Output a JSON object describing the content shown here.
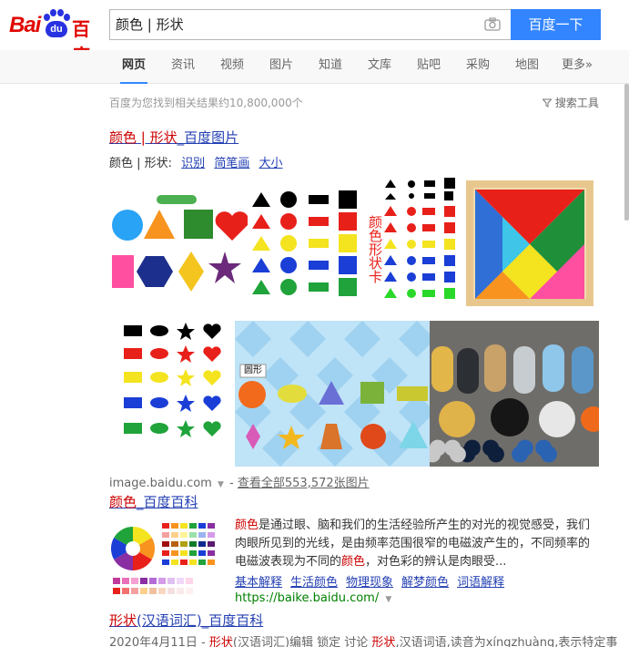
{
  "logo": {
    "text_bai": "Bai",
    "text_du": "du",
    "text_cn": "百度"
  },
  "search": {
    "query": "颜色 | 形状",
    "button_label": "百度一下"
  },
  "tabs": [
    {
      "label": "网页",
      "active": true
    },
    {
      "label": "资讯"
    },
    {
      "label": "视频"
    },
    {
      "label": "图片"
    },
    {
      "label": "知道"
    },
    {
      "label": "文库"
    },
    {
      "label": "贴吧"
    },
    {
      "label": "采购"
    },
    {
      "label": "地图"
    },
    {
      "label": "更多»"
    }
  ],
  "result_count": "百度为您找到相关结果约10,800,000个",
  "search_tools": "搜索工具",
  "result1": {
    "title_em": "颜色 | 形状",
    "title_rest": "_百度图片",
    "sub_prefix": "颜色 | 形状:",
    "sub_links": [
      "识别",
      "简笔画",
      "大小"
    ],
    "tile_text": "颜色形状卡",
    "source": "image.baidu.com",
    "view_all": "查看全部553,572张图片"
  },
  "result2": {
    "title_em": "颜色",
    "title_rest": "_百度百科",
    "desc_em1": "颜色",
    "desc_1": "是通过眼、脑和我们的生活经验所产生的对光的视觉感受，我们肉眼所见到的光线，是由频率范围很窄的电磁波产生的，不同频率的电磁波表现为不同的",
    "desc_em2": "颜色",
    "desc_2": "，对色彩的辨认是肉眼受...",
    "links": [
      "基本解释",
      "生活颜色",
      "物理现象",
      "解梦颜色",
      "词语解释"
    ],
    "url": "https://baike.baidu.com/"
  },
  "result3": {
    "title_em": "形状",
    "title_rest": "(汉语词汇)_百度百科",
    "date": "2020年4月11日 - ",
    "em1": "形状",
    "mid": "(汉语词汇)编辑 锁定 讨论 ",
    "em2": "形状",
    "tail": ",汉语词语,读音为xíngzhuàng,表示特定事"
  },
  "colors": {
    "accent": "#3385ff",
    "link": "#2440b3",
    "emphasis": "#cc0000",
    "url_green": "#008000"
  }
}
